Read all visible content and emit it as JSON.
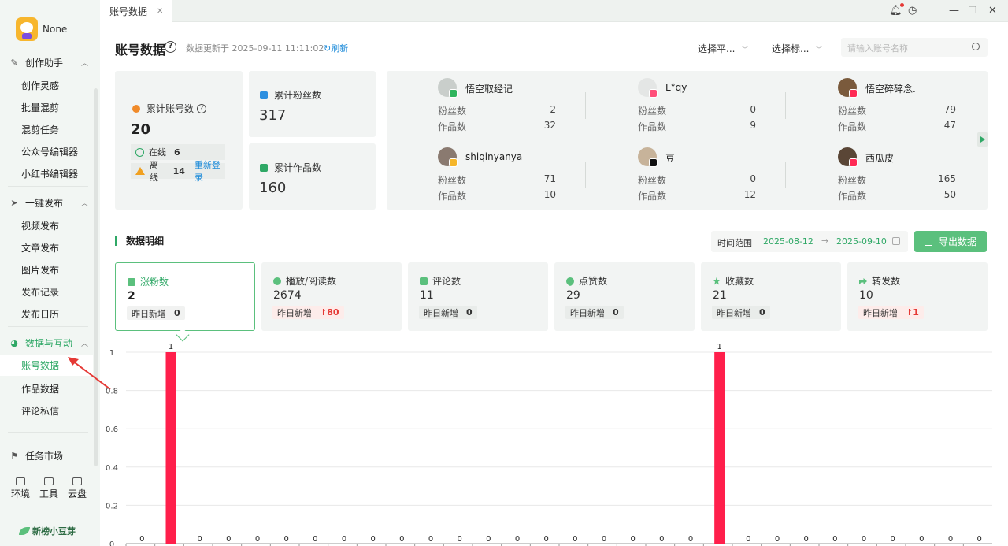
{
  "app": {
    "user_name": "None",
    "tab_title": "账号数据"
  },
  "sidebar": {
    "groups": [
      {
        "label": "创作助手",
        "items": [
          "创作灵感",
          "批量混剪",
          "混剪任务",
          "公众号编辑器",
          "小红书编辑器"
        ]
      },
      {
        "label": "一键发布",
        "items": [
          "视频发布",
          "文章发布",
          "图片发布",
          "发布记录",
          "发布日历"
        ]
      },
      {
        "label": "数据与互动",
        "items": [
          "账号数据",
          "作品数据",
          "评论私信"
        ]
      },
      {
        "label": "任务市场",
        "items": []
      }
    ],
    "active_item": "账号数据",
    "tools": [
      "环境",
      "工具",
      "云盘"
    ],
    "brand": "新榜小豆芽"
  },
  "header": {
    "title": "账号数据",
    "update_text": "数据更新于 2025-09-11 11:11:02",
    "refresh_label": "刷新",
    "platform_select": "选择平...",
    "tag_select": "选择标...",
    "search_placeholder": "请输入账号名称"
  },
  "summary": {
    "total_accounts_label": "累计账号数",
    "total_accounts": "20",
    "online_label": "在线",
    "online_count": "6",
    "offline_label": "离线",
    "offline_count": "14",
    "relogin_label": "重新登录",
    "fans_label": "累计粉丝数",
    "fans_total": "317",
    "works_label": "累计作品数",
    "works_total": "160"
  },
  "accounts": {
    "fans_label": "粉丝数",
    "works_label": "作品数",
    "list": [
      {
        "name": "悟空取经记",
        "fans": "2",
        "works": "32",
        "badge_color": "#2fb55d"
      },
      {
        "name": "L°qy",
        "fans": "0",
        "works": "9",
        "badge_color": "#ff4f7a"
      },
      {
        "name": "悟空碎碎念.",
        "fans": "79",
        "works": "47",
        "badge_color": "#ff2a55"
      },
      {
        "name": "shiqinyanya",
        "fans": "71",
        "works": "10",
        "badge_color": "#f5b62a"
      },
      {
        "name": "豆",
        "fans": "0",
        "works": "12",
        "badge_color": "#111111"
      },
      {
        "name": "西瓜皮",
        "fans": "165",
        "works": "50",
        "badge_color": "#ff2a55"
      }
    ]
  },
  "detail": {
    "section_title": "数据明细",
    "range_label": "时间范围",
    "date_start": "2025-08-12",
    "date_arrow": "→",
    "date_end": "2025-09-10",
    "export_label": "导出数据",
    "yesterday_label": "昨日新增",
    "metrics": [
      {
        "label": "涨粉数",
        "value": "2",
        "delta": "0",
        "up": false
      },
      {
        "label": "播放/阅读数",
        "value": "2674",
        "delta": "80",
        "up": true
      },
      {
        "label": "评论数",
        "value": "11",
        "delta": "0",
        "up": false
      },
      {
        "label": "点赞数",
        "value": "29",
        "delta": "0",
        "up": false
      },
      {
        "label": "收藏数",
        "value": "21",
        "delta": "0",
        "up": false
      },
      {
        "label": "转发数",
        "value": "10",
        "delta": "1",
        "up": true
      }
    ]
  },
  "chart_data": {
    "type": "bar",
    "ylim": [
      0,
      1
    ],
    "yticks": [
      "0",
      "0.2",
      "0.4",
      "0.6",
      "0.8",
      "1"
    ],
    "values": [
      0,
      1,
      0,
      0,
      0,
      0,
      0,
      0,
      0,
      0,
      0,
      0,
      0,
      0,
      0,
      0,
      0,
      0,
      0,
      0,
      1,
      0,
      0,
      0,
      0,
      0,
      0,
      0,
      0,
      0
    ],
    "bar_color": "#ff1f4b",
    "grid": true
  }
}
